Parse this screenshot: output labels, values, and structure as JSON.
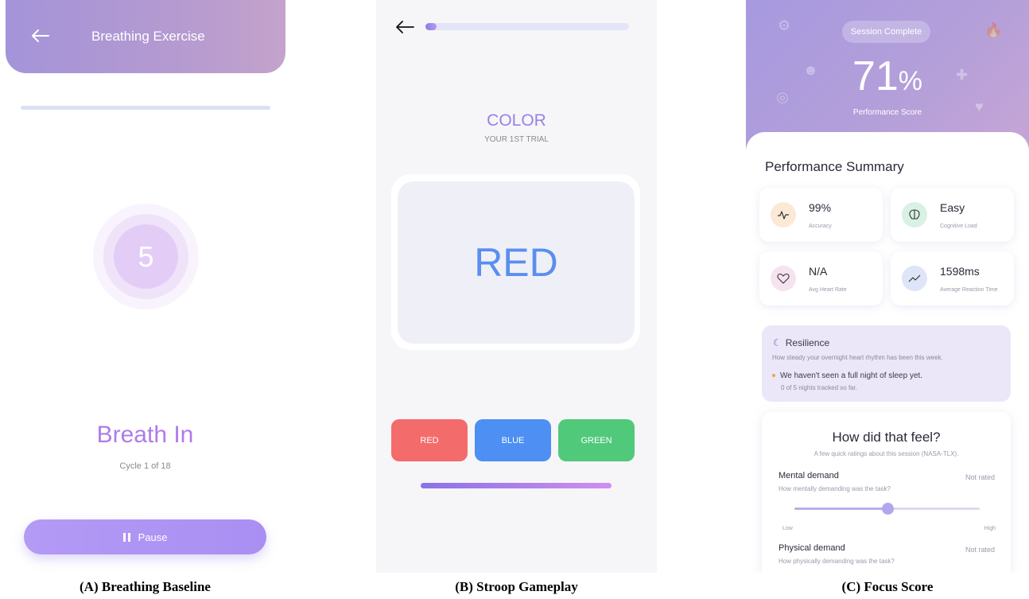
{
  "breathing": {
    "title": "Breathing Exercise",
    "counter": "5",
    "phase": "Breath In",
    "cycle": "Cycle 1 of 18",
    "pause_label": "Pause",
    "accent": "#b07be8"
  },
  "stroop": {
    "title": "COLOR",
    "subtitle": "YOUR 1ST TRIAL",
    "word": "RED",
    "word_color": "#5a8ef0",
    "progress": 0.05,
    "timer": 1.0,
    "buttons": [
      {
        "label": "RED",
        "color": "#f46b6b"
      },
      {
        "label": "BLUE",
        "color": "#4d8ff2"
      },
      {
        "label": "GREEN",
        "color": "#50c97a"
      }
    ]
  },
  "focus": {
    "badge": "Session Complete",
    "score_value": "71",
    "score_unit": "%",
    "score_label": "Performance Score",
    "summary_title": "Performance Summary",
    "metrics": [
      {
        "value": "99%",
        "label": "Accuracy",
        "icon": "pulse-icon"
      },
      {
        "value": "Easy",
        "label": "Cognitive Load",
        "icon": "brain-icon"
      },
      {
        "value": "N/A",
        "label": "Avg Heart Rate",
        "icon": "heart-icon"
      },
      {
        "value": "1598ms",
        "label": "Average Reaction Time",
        "icon": "trend-icon"
      }
    ],
    "resilience": {
      "title": "Resilience",
      "description": "How steady your overnight heart rhythm has been this week.",
      "bullet": "We haven't seen a full night of sleep yet.",
      "count": "0 of 5 nights tracked so far."
    },
    "feel": {
      "title": "How did that feel?",
      "subtitle": "A few quick ratings about this session (NASA-TLX).",
      "questions": [
        {
          "label": "Mental demand",
          "description": "How mentally demanding was the task?",
          "status": "Not rated",
          "value": 0.5
        },
        {
          "label": "Physical demand",
          "description": "How physically demanding was the task?",
          "status": "Not rated"
        }
      ],
      "slider_min": "Low",
      "slider_max": "High"
    }
  },
  "captions": {
    "a": "(A) Breathing Baseline",
    "b": "(B) Stroop Gameplay",
    "c": "(C) Focus Score"
  }
}
